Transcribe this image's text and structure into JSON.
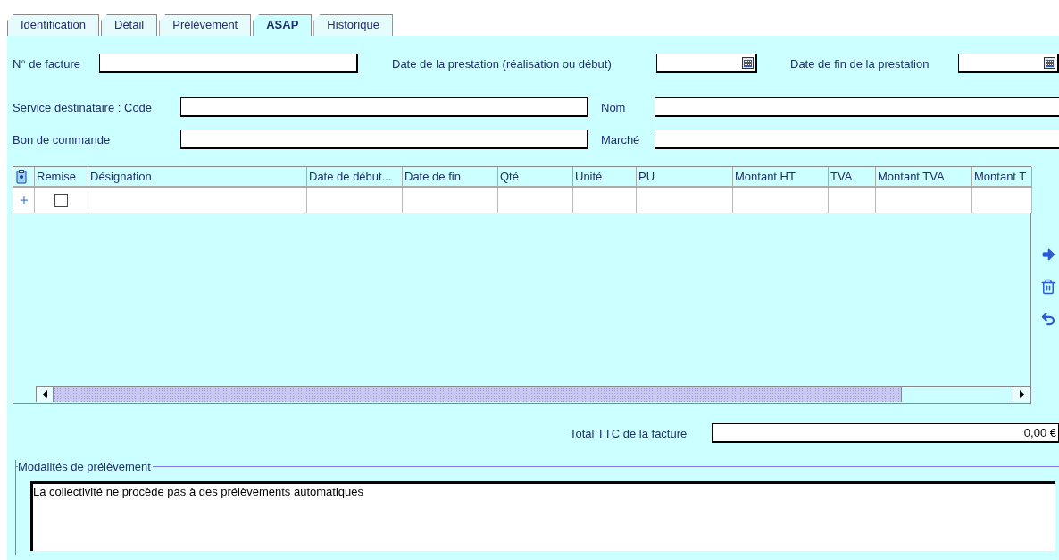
{
  "tabs": [
    {
      "label": "Identification",
      "selected": false
    },
    {
      "label": "Détail",
      "selected": false
    },
    {
      "label": "Prélèvement",
      "selected": false
    },
    {
      "label": "ASAP",
      "selected": true
    },
    {
      "label": "Historique",
      "selected": false
    }
  ],
  "header_fields": [
    [
      {
        "label": "N° de facture",
        "kind": "text"
      },
      {
        "label": "Date de la prestation (réalisation ou début)",
        "kind": "date"
      },
      {
        "label": "Date de fin de la prestation",
        "kind": "date"
      }
    ],
    [
      {
        "label": "Service destinataire : Code",
        "kind": "text"
      },
      {
        "label": "Nom",
        "kind": "text"
      }
    ],
    [
      {
        "label": "Bon de commande",
        "kind": "text"
      },
      {
        "label": "Marché",
        "kind": "text"
      }
    ]
  ],
  "table": {
    "columns": [
      "Remise",
      "Désignation",
      "Date de début...",
      "Date de fin",
      "Qté",
      "Unité",
      "PU",
      "Montant HT",
      "TVA",
      "Montant TVA",
      "Montant T"
    ],
    "rows": [
      {
        "remise_checked": false
      }
    ]
  },
  "total": {
    "label": "Total TTC de la facture",
    "value": "0,00 €"
  },
  "modalites": {
    "title": "Modalités de prélèvement",
    "value": "La collectivité ne procède pas à des prélèvements automatiques"
  }
}
